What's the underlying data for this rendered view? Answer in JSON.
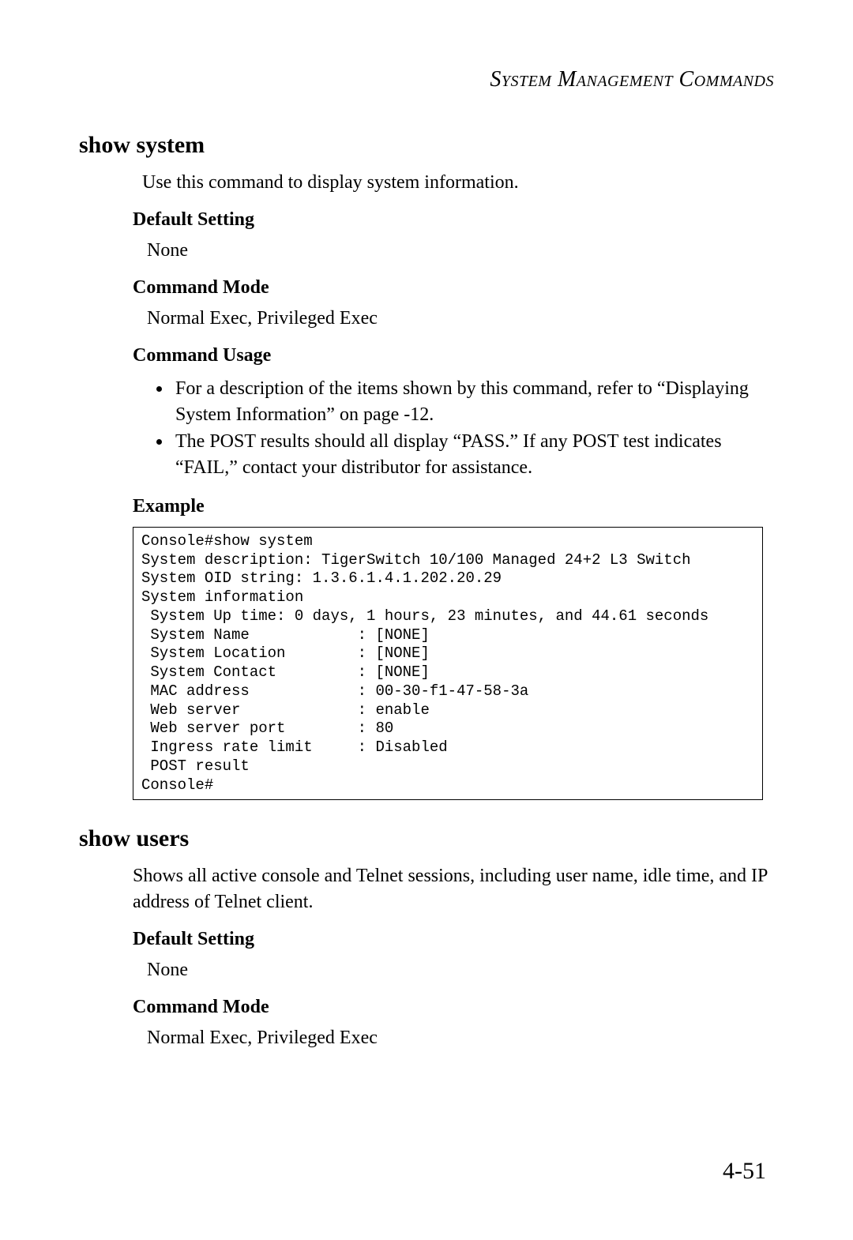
{
  "header": "System Management Commands",
  "section1": {
    "title": "show system",
    "intro": "Use this command to display system information.",
    "default_setting_label": "Default Setting",
    "default_setting_value": "None",
    "command_mode_label": "Command Mode",
    "command_mode_value": "Normal Exec, Privileged Exec",
    "command_usage_label": "Command Usage",
    "usage_item1": "For a description of the items shown by this command, refer to “Displaying System Information” on page -12.",
    "usage_item2": "The POST results should all display “PASS.” If any POST test indicates “FAIL,” contact your distributor for assistance.",
    "example_label": "Example",
    "example_output": "Console#show system\nSystem description: TigerSwitch 10/100 Managed 24+2 L3 Switch\nSystem OID string: 1.3.6.1.4.1.202.20.29\nSystem information\n System Up time: 0 days, 1 hours, 23 minutes, and 44.61 seconds\n System Name            : [NONE]\n System Location        : [NONE]\n System Contact         : [NONE]\n MAC address            : 00-30-f1-47-58-3a\n Web server             : enable\n Web server port        : 80\n Ingress rate limit     : Disabled\n POST result\nConsole#"
  },
  "section2": {
    "title": "show users",
    "intro": "Shows all active console and Telnet sessions, including user name, idle time, and IP address of Telnet client.",
    "default_setting_label": "Default Setting",
    "default_setting_value": "None",
    "command_mode_label": "Command Mode",
    "command_mode_value": "Normal Exec, Privileged Exec"
  },
  "page_number": "4-51"
}
